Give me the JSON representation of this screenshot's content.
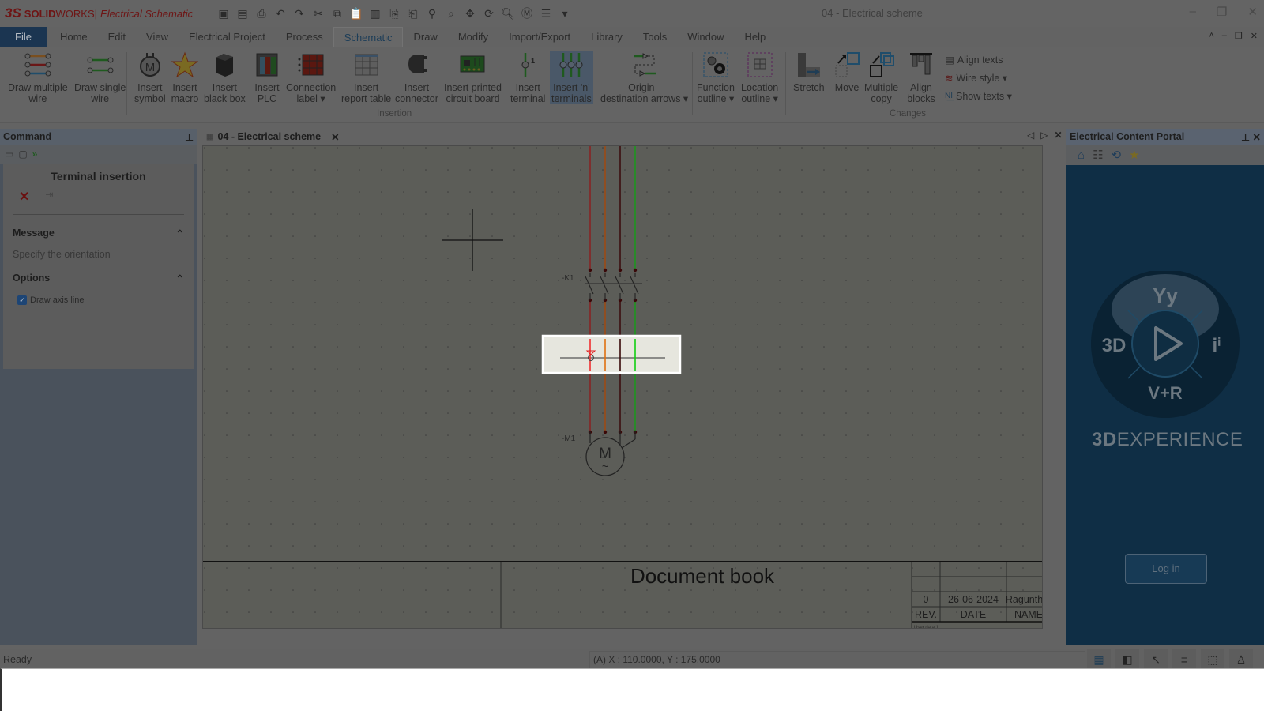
{
  "app": {
    "brand_ds": "3S",
    "brand_solid": "SOLID",
    "brand_works": "WORKS",
    "brand_sep": " | ",
    "product": "Electrical Schematic",
    "window_title": "04 - Electrical scheme"
  },
  "quick_access": [
    "new-icon",
    "save-icon",
    "print-icon",
    "undo-icon",
    "redo-icon",
    "cut-icon",
    "copy-icon",
    "paste-icon",
    "paste-special-icon",
    "copy-file-icon",
    "paste-file-icon",
    "zoom-icon",
    "zoom-window-icon",
    "pan-icon",
    "redraw-icon",
    "search-icon",
    "macro-icon",
    "wire-icon",
    "customize-icon"
  ],
  "menu": [
    "File",
    "Home",
    "Edit",
    "View",
    "Electrical Project",
    "Process",
    "Schematic",
    "Draw",
    "Modify",
    "Import/Export",
    "Library",
    "Tools",
    "Window",
    "Help"
  ],
  "menu_active": "Schematic",
  "ribbon": {
    "buttons": [
      {
        "id": "draw-multiple-wire",
        "line1": "Draw multiple",
        "line2": "wire"
      },
      {
        "id": "draw-single-wire",
        "line1": "Draw single",
        "line2": "wire"
      },
      {
        "id": "insert-symbol",
        "line1": "Insert",
        "line2": "symbol"
      },
      {
        "id": "insert-macro",
        "line1": "Insert",
        "line2": "macro"
      },
      {
        "id": "insert-black-box",
        "line1": "Insert",
        "line2": "black box"
      },
      {
        "id": "insert-plc",
        "line1": "Insert",
        "line2": "PLC"
      },
      {
        "id": "connection-label",
        "line1": "Connection",
        "line2": "label ▾"
      },
      {
        "id": "insert-report-table",
        "line1": "Insert",
        "line2": "report table"
      },
      {
        "id": "insert-connector",
        "line1": "Insert",
        "line2": "connector"
      },
      {
        "id": "insert-pcb",
        "line1": "Insert printed",
        "line2": "circuit board"
      },
      {
        "id": "insert-terminal",
        "line1": "Insert",
        "line2": "terminal"
      },
      {
        "id": "insert-n-terminals",
        "line1": "Insert 'n'",
        "line2": "terminals"
      },
      {
        "id": "origin-destination-arrows",
        "line1": "Origin -",
        "line2": "destination arrows ▾"
      },
      {
        "id": "function-outline",
        "line1": "Function",
        "line2": "outline ▾"
      },
      {
        "id": "location-outline",
        "line1": "Location",
        "line2": "outline ▾"
      },
      {
        "id": "stretch",
        "line1": "Stretch",
        "line2": ""
      },
      {
        "id": "move",
        "line1": "Move",
        "line2": ""
      },
      {
        "id": "multiple-copy",
        "line1": "Multiple",
        "line2": "copy"
      },
      {
        "id": "align-blocks",
        "line1": "Align",
        "line2": "blocks"
      }
    ],
    "small_buttons": [
      {
        "id": "align-texts",
        "label": "Align texts"
      },
      {
        "id": "wire-style",
        "label": "Wire style ▾"
      },
      {
        "id": "show-texts",
        "label": "Show texts ▾"
      }
    ],
    "groups": {
      "insertion": "Insertion",
      "changes": "Changes"
    }
  },
  "command_panel": {
    "header": "Command",
    "title": "Terminal insertion",
    "message_header": "Message",
    "message_text": "Specify the orientation",
    "options_header": "Options",
    "draw_axis_line_label": "Draw axis line",
    "draw_axis_line_checked": true
  },
  "document_tab": {
    "label": "04 - Electrical scheme"
  },
  "schematic": {
    "contactor_label": "-K1",
    "motor_label": "-M1",
    "motor_symbol": "M",
    "motor_ac": "~",
    "wire_colors": [
      "#8a2020",
      "#a04a10",
      "#3a0a0a",
      "#1a9a1a"
    ],
    "title_block": {
      "title": "Document book",
      "rev_value": "0",
      "date_value": "26-06-2024",
      "name_value": "Raguntha",
      "rev_header": "REV.",
      "date_header": "DATE",
      "name_header": "NAME",
      "footer_partial": "User data 1"
    }
  },
  "portal": {
    "header": "Electrical Content Portal",
    "tools": [
      "home-icon",
      "list-icon",
      "update-icon",
      "favorites-icon"
    ],
    "compass_left": "3D",
    "compass_right": "iⁱ",
    "compass_bottom": "V+R",
    "brand_bold": "3D",
    "brand_rest": "EXPERIENCE",
    "login_label": "Log in"
  },
  "status": {
    "ready": "Ready",
    "coords": "(A) X : 110.0000, Y : 175.0000"
  }
}
